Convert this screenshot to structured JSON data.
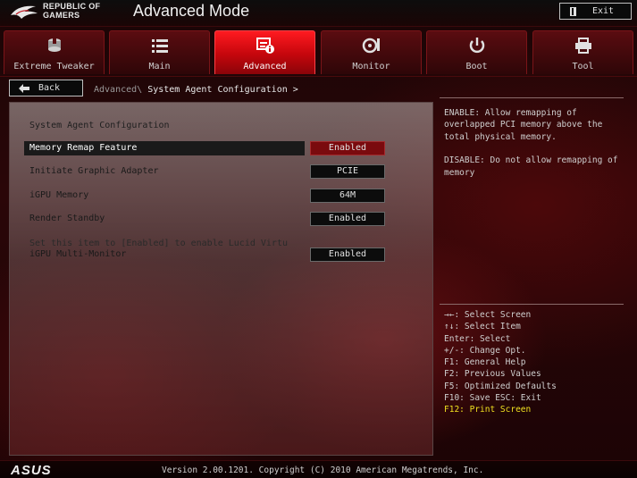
{
  "header": {
    "brand_line1": "REPUBLIC OF",
    "brand_line2": "GAMERS",
    "mode_title": "Advanced Mode",
    "exit_label": "Exit"
  },
  "tabs": [
    {
      "label": "Extreme Tweaker",
      "icon": "tweaker-icon",
      "active": false
    },
    {
      "label": "Main",
      "icon": "list-icon",
      "active": false
    },
    {
      "label": "Advanced",
      "icon": "advanced-info-icon",
      "active": true
    },
    {
      "label": "Monitor",
      "icon": "monitor-gauge-icon",
      "active": false
    },
    {
      "label": "Boot",
      "icon": "power-icon",
      "active": false
    },
    {
      "label": "Tool",
      "icon": "printer-tool-icon",
      "active": false
    }
  ],
  "nav": {
    "back_label": "Back",
    "breadcrumb_parent": "Advanced\\",
    "breadcrumb_current": " System Agent Configuration >"
  },
  "panel": {
    "title": "System Agent Configuration",
    "settings": [
      {
        "name": "Memory Remap Feature",
        "value": "Enabled",
        "selected": true
      },
      {
        "name": "Initiate Graphic Adapter",
        "value": "PCIE",
        "selected": false
      },
      {
        "name": "iGPU Memory",
        "value": "64M",
        "selected": false
      },
      {
        "name": "Render Standby",
        "value": "Enabled",
        "selected": false
      },
      {
        "name": "iGPU Multi-Monitor",
        "value": "Enabled",
        "selected": false
      }
    ],
    "note": "Set this item to [Enabled] to enable Lucid Virtu"
  },
  "help": {
    "enable_text": "ENABLE: Allow remapping of overlapped PCI memory above the total physical memory.",
    "disable_text": "DISABLE: Do not allow remapping of memory"
  },
  "keys": [
    "→←: Select Screen",
    "↑↓: Select Item",
    "Enter: Select",
    "+/-: Change Opt.",
    "F1: General Help",
    "F2: Previous Values",
    "F5: Optimized Defaults",
    "F10: Save  ESC: Exit",
    "F12: Print Screen"
  ],
  "footer": {
    "logo_text": "ASUS",
    "version": "Version 2.00.1201. Copyright (C) 2010 American Megatrends, Inc."
  },
  "colors": {
    "accent": "#e0141a",
    "selected_value_bg": "#7a0a0e",
    "highlight_key": "#f0e020"
  }
}
